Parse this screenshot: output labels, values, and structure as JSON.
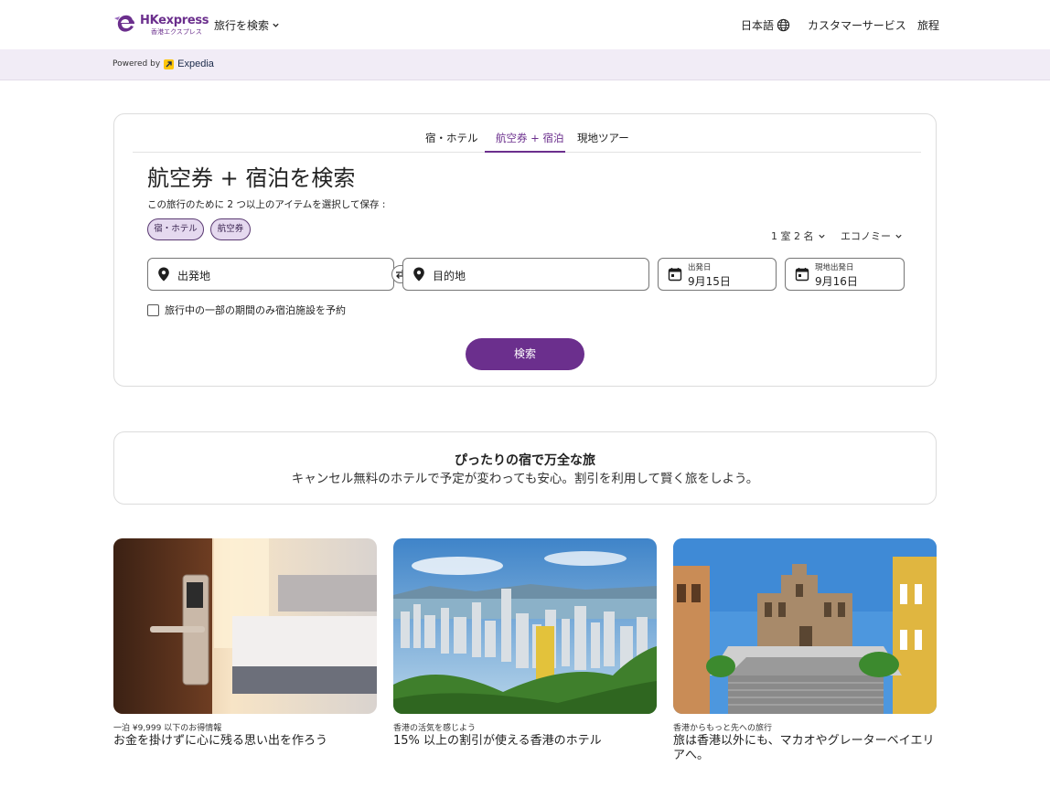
{
  "header": {
    "logo_brand": "HKexpress",
    "logo_sub": "香港エクスプレス",
    "nav_search": "旅行を検索",
    "language": "日本語",
    "customer_service": "カスタマーサービス",
    "trips": "旅程"
  },
  "powered": {
    "label": "Powered by",
    "brand": "Expedia"
  },
  "search": {
    "tabs": [
      {
        "label": "宿・ホテル",
        "active": false
      },
      {
        "label": "航空券 + 宿泊",
        "active": true
      },
      {
        "label": "現地ツアー",
        "active": false
      }
    ],
    "title": "航空券 + 宿泊を検索",
    "subtitle": "この旅行のために 2 つ以上のアイテムを選択して保存 :",
    "chips": [
      "宿・ホテル",
      "航空券"
    ],
    "travelers": "1 室 2 名",
    "cabin_class": "エコノミー",
    "origin_placeholder": "出発地",
    "destination_placeholder": "目的地",
    "depart_label": "出発日",
    "depart_value": "9月15日",
    "return_label": "現地出発日",
    "return_value": "9月16日",
    "partial_stay_label": "旅行中の一部の期間のみ宿泊施設を予約",
    "partial_stay_checked": false,
    "search_button": "検索"
  },
  "promo": {
    "title": "ぴったりの宿で万全な旅",
    "subtitle": "キャンセル無料のホテルで予定が変わっても安心。割引を利用して賢く旅をしよう。"
  },
  "cards": [
    {
      "kicker": "一泊 ¥9,999 以下のお得情報",
      "title": "お金を掛けずに心に残る思い出を作ろう"
    },
    {
      "kicker": "香港の活気を感じよう",
      "title": "15% 以上の割引が使える香港のホテル"
    },
    {
      "kicker": "香港からもっと先への旅行",
      "title": "旅は香港以外にも、マカオやグレーターベイエリアへ。"
    }
  ],
  "colors": {
    "brand_purple": "#6b2f8d",
    "chip_bg": "#e5d9ef",
    "powered_bar_bg": "#f1ecf6",
    "expedia_yellow": "#ffc60a"
  }
}
